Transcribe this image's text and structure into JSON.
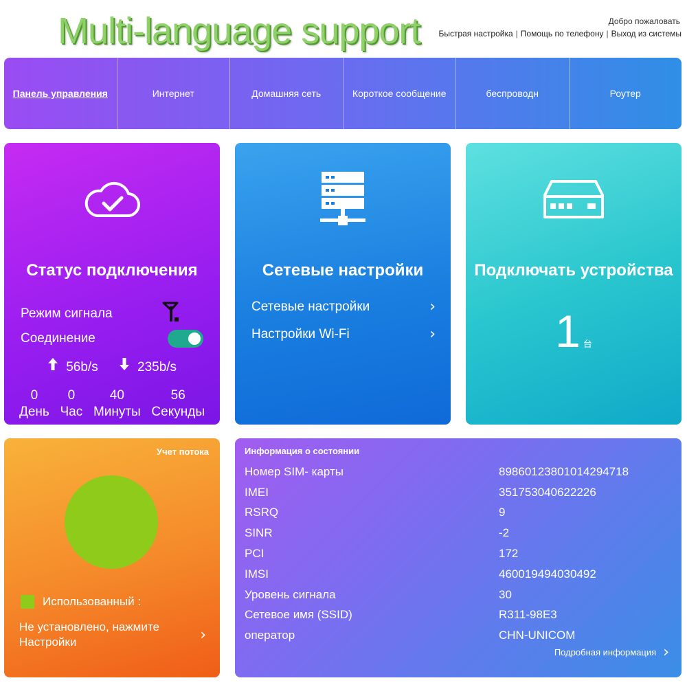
{
  "header": {
    "headline": "Multi-language support",
    "welcome": "Добро пожаловать",
    "links": [
      "Быстрая настройка",
      "Помощь по телефону",
      "Выход из системы"
    ]
  },
  "nav": {
    "items": [
      {
        "label": "Панель управления",
        "active": true
      },
      {
        "label": "Интернет"
      },
      {
        "label": "Домашняя сеть"
      },
      {
        "label": "Короткое сообщение"
      },
      {
        "label": "беспроводн"
      },
      {
        "label": "Роутер"
      }
    ]
  },
  "status_card": {
    "title": "Статус подключения",
    "signal_label": "Режим сигнала",
    "connection_label": "Соединение",
    "connection_on": true,
    "upload": "56b/s",
    "download": "235b/s",
    "timer": [
      {
        "value": "0",
        "unit": "День"
      },
      {
        "value": "0",
        "unit": "Час"
      },
      {
        "value": "40",
        "unit": "Минуты"
      },
      {
        "value": "56",
        "unit": "Секунды"
      }
    ]
  },
  "network_card": {
    "title": "Сетевые настройки",
    "links": [
      "Сетевые настройки",
      "Настройки Wi-Fi"
    ]
  },
  "devices_card": {
    "title": "Подключать устройства",
    "count": "1",
    "unit": "台"
  },
  "flow_card": {
    "title": "Учет потока",
    "used_label": "Использованный :",
    "used_color": "#8fcb1a",
    "link": "Не установлено, нажмите Настройки"
  },
  "info_card": {
    "title": "Информация о состоянии",
    "rows": [
      {
        "key": "Номер SIM- карты",
        "value": "89860123801014294718"
      },
      {
        "key": "IMEI",
        "value": "351753040622226"
      },
      {
        "key": "RSRQ",
        "value": "9"
      },
      {
        "key": "SINR",
        "value": "-2"
      },
      {
        "key": "PCI",
        "value": "172"
      },
      {
        "key": "IMSI",
        "value": "460019494030492"
      },
      {
        "key": "Уровень сигнала",
        "value": "30"
      },
      {
        "key": "Сетевое имя (SSID)",
        "value": "R311-98E3"
      },
      {
        "key": "оператор",
        "value": "CHN-UNICOM"
      }
    ],
    "more": "Подробная информация"
  },
  "icons": {
    "status": "cloud-check-icon",
    "network": "server-network-icon",
    "devices": "router-icon",
    "signal": "antenna-icon",
    "upload": "arrow-up-icon",
    "download": "arrow-down-icon",
    "chevron": "chevron-right-icon"
  }
}
